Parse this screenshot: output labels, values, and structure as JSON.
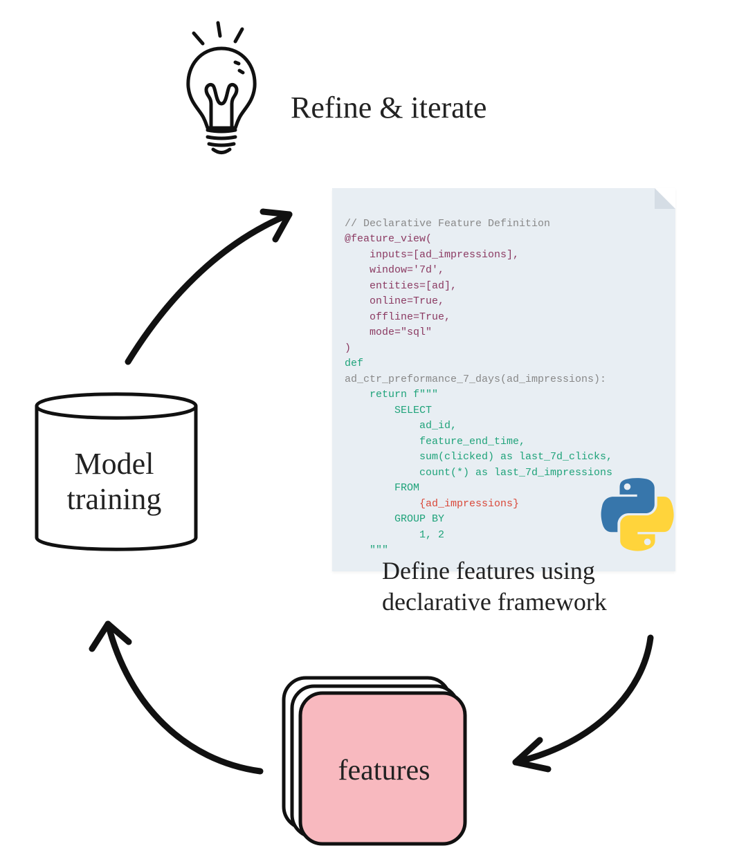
{
  "labels": {
    "refine": "Refine & iterate",
    "define_line1": "Define features using",
    "define_line2": "declarative framework",
    "model_training_line1": "Model",
    "model_training_line2": "training",
    "features": "features"
  },
  "code": {
    "header_comment": "// Declarative Feature Definition",
    "decorator_open": "@feature_view(",
    "arg_inputs": "    inputs=[ad_impressions],",
    "arg_window": "    window='7d',",
    "arg_entities": "    entities=[ad],",
    "arg_online": "    online=True,",
    "arg_offline": "    offline=True,",
    "arg_mode": "    mode=\"sql\"",
    "decorator_close": ")",
    "def_kw": "def",
    "func_sig": "ad_ctr_preformance_7_days(ad_impressions):",
    "return_kw": "    return ",
    "fstr_open": "f\"\"\"",
    "sql_select": "        SELECT",
    "sql_ad_id": "            ad_id,",
    "sql_feat_end": "            feature_end_time,",
    "sql_sum": "            sum(clicked) as last_7d_clicks,",
    "sql_count": "            count(*) as last_7d_impressions",
    "sql_from": "        FROM",
    "sql_interp": "            {ad_impressions}",
    "sql_groupby": "        GROUP BY",
    "sql_12": "            1, 2",
    "fstr_close": "    \"\"\""
  },
  "icons": {
    "lightbulb": "lightbulb-icon",
    "python": "python-logo-icon"
  }
}
